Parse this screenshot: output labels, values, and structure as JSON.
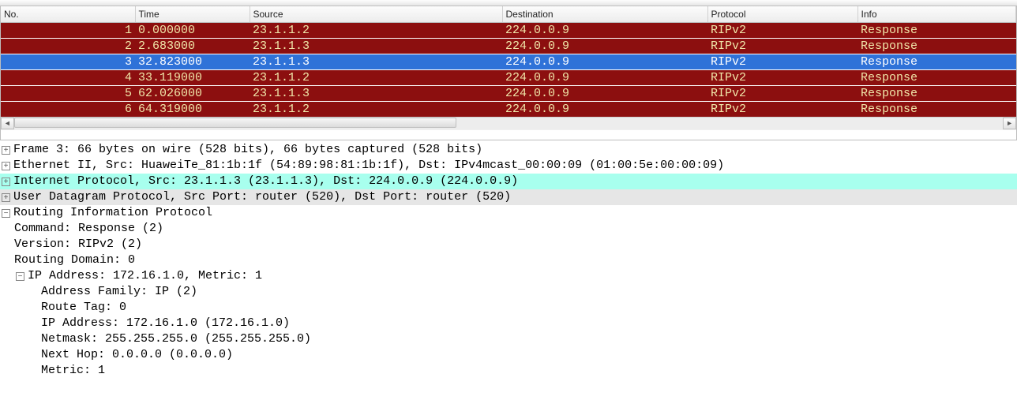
{
  "columns": {
    "no": "No.",
    "time": "Time",
    "source": "Source",
    "destination": "Destination",
    "protocol": "Protocol",
    "info": "Info"
  },
  "packets": [
    {
      "no": "1",
      "time": "0.000000",
      "source": "23.1.1.2",
      "destination": "224.0.0.9",
      "protocol": "RIPv2",
      "info": "Response",
      "selected": false,
      "break": false
    },
    {
      "no": "2",
      "time": "2.683000",
      "source": "23.1.1.3",
      "destination": "224.0.0.9",
      "protocol": "RIPv2",
      "info": "Response",
      "selected": false,
      "break": false
    },
    {
      "no": "3",
      "time": "32.823000",
      "source": "23.1.1.3",
      "destination": "224.0.0.9",
      "protocol": "RIPv2",
      "info": "Response",
      "selected": true,
      "break": false
    },
    {
      "no": "4",
      "time": "33.119000",
      "source": "23.1.1.2",
      "destination": "224.0.0.9",
      "protocol": "RIPv2",
      "info": "Response",
      "selected": false,
      "break": false
    },
    {
      "no": "5",
      "time": "62.026000",
      "source": "23.1.1.3",
      "destination": "224.0.0.9",
      "protocol": "RIPv2",
      "info": "Response",
      "selected": false,
      "break": true
    },
    {
      "no": "6",
      "time": "64.319000",
      "source": "23.1.1.2",
      "destination": "224.0.0.9",
      "protocol": "RIPv2",
      "info": "Response",
      "selected": false,
      "break": false
    }
  ],
  "details": {
    "frame": "Frame 3: 66 bytes on wire (528 bits), 66 bytes captured (528 bits)",
    "eth": "Ethernet II, Src: HuaweiTe_81:1b:1f (54:89:98:81:1b:1f), Dst: IPv4mcast_00:00:09 (01:00:5e:00:00:09)",
    "ip": "Internet Protocol, Src: 23.1.1.3 (23.1.1.3), Dst: 224.0.0.9 (224.0.0.9)",
    "udp": "User Datagram Protocol, Src Port: router (520), Dst Port: router (520)",
    "rip": "Routing Information Protocol",
    "command": "Command: Response (2)",
    "version": "Version: RIPv2 (2)",
    "domain": "Routing Domain: 0",
    "ipaddr_h": "IP Address: 172.16.1.0, Metric: 1",
    "afi": "Address Family: IP (2)",
    "tag": "Route Tag: 0",
    "ipaddr": "IP Address: 172.16.1.0 (172.16.1.0)",
    "netmask": "Netmask: 255.255.255.0 (255.255.255.0)",
    "nexthop": "Next Hop: 0.0.0.0 (0.0.0.0)",
    "metric": "Metric: 1"
  },
  "toggles": {
    "plus": "+",
    "minus": "−"
  },
  "scroll": {
    "left": "◄",
    "right": "►"
  }
}
